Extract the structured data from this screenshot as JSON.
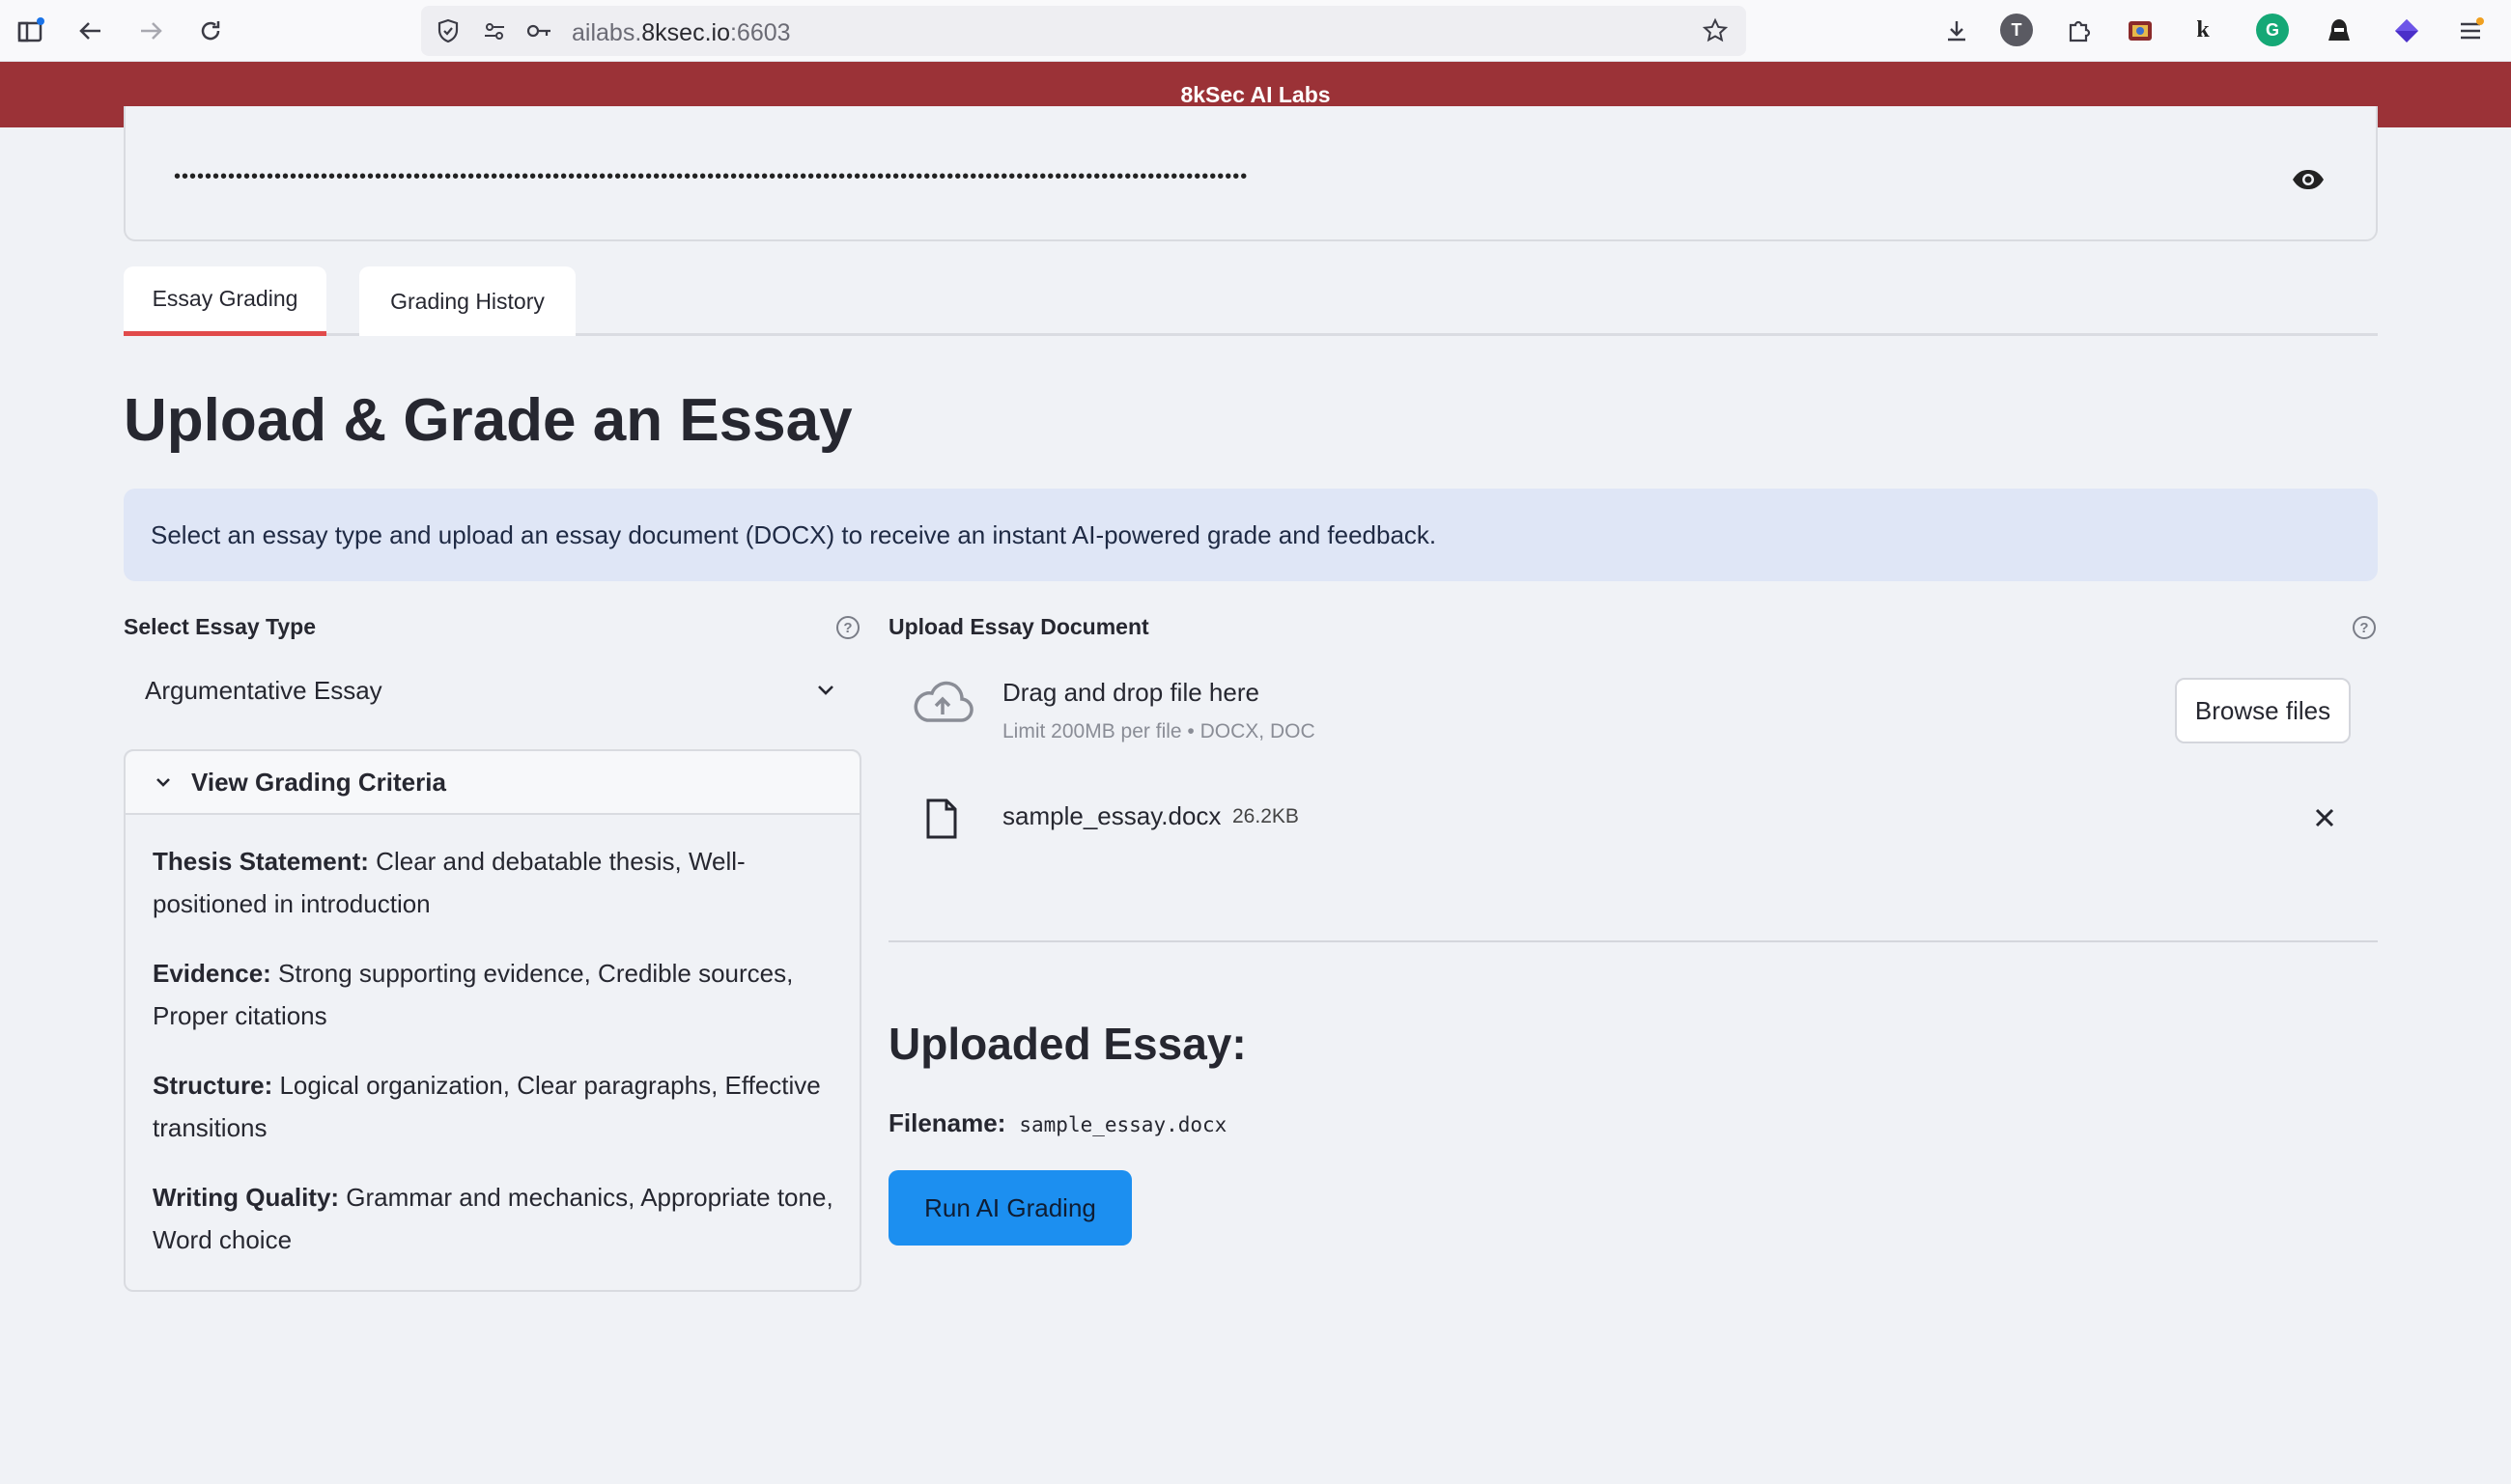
{
  "browser": {
    "url_host_prefix": "ailabs.",
    "url_host_main": "8ksec.io",
    "url_port": ":6603",
    "ext_t_label": "T",
    "ext_g_label": "G",
    "ext_k_label": "k"
  },
  "app": {
    "header_title": "8kSec AI Labs"
  },
  "secret": {
    "masked_value": "•••••••••••••••••••••••••••••••••••••••••••••••••••••••••••••••••••••••••••••••••••••••••••••••••••••••••••••••••••••••••••••••••••••••••••"
  },
  "tabs": [
    {
      "label": "Essay Grading",
      "active": true
    },
    {
      "label": "Grading History",
      "active": false
    }
  ],
  "main": {
    "title": "Upload & Grade an Essay",
    "info": "Select an essay type and upload an essay document (DOCX) to receive an instant AI-powered grade and feedback.",
    "help_glyph": "?"
  },
  "essay_type": {
    "label": "Select Essay Type",
    "selected": "Argumentative Essay"
  },
  "criteria": {
    "header": "View Grading Criteria",
    "items": [
      {
        "name": "Thesis Statement:",
        "desc": " Clear and debatable thesis, Well-positioned in introduction"
      },
      {
        "name": "Evidence:",
        "desc": " Strong supporting evidence, Credible sources, Proper citations"
      },
      {
        "name": "Structure:",
        "desc": " Logical organization, Clear paragraphs, Effective transitions"
      },
      {
        "name": "Writing Quality:",
        "desc": " Grammar and mechanics, Appropriate tone, Word choice"
      }
    ]
  },
  "upload": {
    "label": "Upload Essay Document",
    "drag_title": "Drag and drop file here",
    "drag_sub": "Limit 200MB per file • DOCX, DOC",
    "browse_label": "Browse files",
    "file_name": "sample_essay.docx",
    "file_size": "26.2KB"
  },
  "uploaded": {
    "title": "Uploaded Essay:",
    "filename_label": "Filename:",
    "filename_value": "sample_essay.docx",
    "run_label": "Run AI Grading"
  },
  "colors": {
    "header_bg": "#9b3237",
    "accent": "#e14b4b",
    "info_bg": "#dfe6f6",
    "primary_button": "#1c8ff0"
  }
}
